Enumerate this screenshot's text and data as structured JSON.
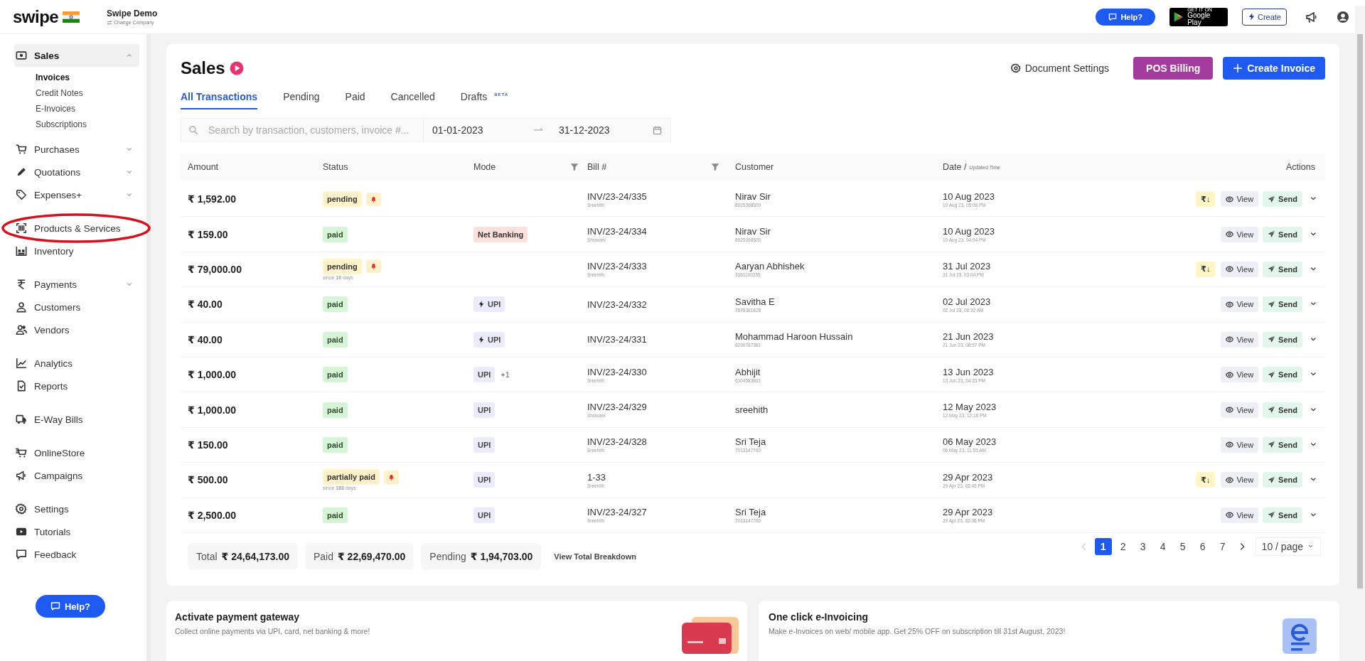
{
  "topbar": {
    "logo": "swipe",
    "company": "Swipe Demo",
    "change_company": "Change Company",
    "help": "Help?",
    "store_badge": {
      "small": "GET IT ON",
      "large": "Google Play"
    },
    "create": "Create"
  },
  "sidebar": {
    "groups": [
      [
        {
          "label": "Sales",
          "expanded": true,
          "selected": true,
          "children": [
            {
              "label": "Invoices",
              "selected": true
            },
            {
              "label": "Credit Notes",
              "selected": false
            },
            {
              "label": "E-Invoices",
              "selected": false
            },
            {
              "label": "Subscriptions",
              "selected": false
            }
          ]
        },
        {
          "label": "Purchases",
          "expanded": false,
          "selected": false
        },
        {
          "label": "Quotations",
          "expanded": false,
          "selected": false
        },
        {
          "label": "Expenses+",
          "expanded": false,
          "selected": false
        }
      ],
      [
        {
          "label": "Products & Services",
          "selected": false,
          "highlighted": true
        },
        {
          "label": "Inventory",
          "selected": false
        }
      ],
      [
        {
          "label": "Payments",
          "expanded": false,
          "selected": false
        },
        {
          "label": "Customers",
          "selected": false
        },
        {
          "label": "Vendors",
          "selected": false
        }
      ],
      [
        {
          "label": "Analytics",
          "selected": false
        },
        {
          "label": "Reports",
          "selected": false
        }
      ],
      [
        {
          "label": "E-Way Bills",
          "selected": false
        }
      ],
      [
        {
          "label": "OnlineStore",
          "selected": false
        },
        {
          "label": "Campaigns",
          "selected": false
        }
      ],
      [
        {
          "label": "Settings",
          "selected": false
        },
        {
          "label": "Tutorials",
          "selected": false
        },
        {
          "label": "Feedback",
          "selected": false
        }
      ]
    ],
    "help": "Help?"
  },
  "page": {
    "title": "Sales",
    "document_settings": "Document Settings",
    "pos_billing": "POS Billing",
    "create_invoice": "Create Invoice"
  },
  "tabs": [
    {
      "label": "All Transactions",
      "selected": true
    },
    {
      "label": "Pending",
      "selected": false
    },
    {
      "label": "Paid",
      "selected": false
    },
    {
      "label": "Cancelled",
      "selected": false
    },
    {
      "label": "Drafts",
      "selected": false,
      "badge": "BETA"
    }
  ],
  "search": {
    "placeholder": "Search by transaction, customers, invoice #...",
    "date_from": "01-01-2023",
    "date_to": "31-12-2023"
  },
  "table": {
    "columns": [
      {
        "label": "Amount",
        "filter": false
      },
      {
        "label": "Status",
        "filter": false
      },
      {
        "label": "Mode",
        "filter": true
      },
      {
        "label": "Bill #",
        "filter": true
      },
      {
        "label": "Customer",
        "filter": false
      },
      {
        "label": "Date /",
        "sublabel": "Updated Time",
        "filter": false
      },
      {
        "label": "Actions",
        "filter": false
      }
    ],
    "rows": [
      {
        "amount": "₹ 1,592.00",
        "status": {
          "label": "pending",
          "kind": "pending",
          "alert": true
        },
        "bill": "INV/23-24/335",
        "bill_sub": "Sreehith",
        "customer": "Nirav Sir",
        "phone": "8925398500",
        "date": "10 Aug 2023",
        "time": "10 Aug 23, 05:08 PM",
        "remind": "₹↓",
        "view": "View",
        "send": "Send"
      },
      {
        "amount": "₹ 159.00",
        "status": {
          "label": "paid",
          "kind": "paid",
          "alert": false
        },
        "mode": {
          "label": "Net Banking",
          "kind": "netbanking",
          "bolt": false
        },
        "bill": "INV/23-24/334",
        "bill_sub": "Shravani",
        "customer": "Nirav Sir",
        "phone": "8925398500",
        "date": "10 Aug 2023",
        "time": "10 Aug 23, 04:04 PM",
        "view": "View",
        "send": "Send"
      },
      {
        "amount": "₹ 79,000.00",
        "status": {
          "label": "pending",
          "kind": "pending",
          "alert": true,
          "note": "since **10** days"
        },
        "bill": "INV/23-24/333",
        "bill_sub": "Sreehith",
        "customer": "Aaryan Abhishek",
        "phone": "3361100255",
        "date": "31 Jul 2023",
        "time": "31 Jul 23, 03:04 PM",
        "remind": "₹↓",
        "view": "View",
        "send": "Send"
      },
      {
        "amount": "₹ 40.00",
        "status": {
          "label": "paid",
          "kind": "paid",
          "alert": false
        },
        "mode": {
          "label": "UPI",
          "kind": "upi",
          "bolt": true
        },
        "bill": "INV/23-24/332",
        "customer": "Savitha E",
        "phone": "7878381828",
        "date": "02 Jul 2023",
        "time": "02 Jul 23, 08:32 AM",
        "view": "View",
        "send": "Send"
      },
      {
        "amount": "₹ 40.00",
        "status": {
          "label": "paid",
          "kind": "paid",
          "alert": false
        },
        "mode": {
          "label": "UPI",
          "kind": "upi",
          "bolt": true
        },
        "bill": "INV/23-24/331",
        "customer": "Mohammad Haroon Hussain",
        "phone": "8290787381",
        "date": "21 Jun 2023",
        "time": "21 Jun 23, 08:57 PM",
        "view": "View",
        "send": "Send"
      },
      {
        "amount": "₹ 1,000.00",
        "status": {
          "label": "paid",
          "kind": "paid",
          "alert": false
        },
        "mode": {
          "label": "UPI",
          "kind": "upi",
          "bolt": false,
          "extra": "+1"
        },
        "bill": "INV/23-24/330",
        "bill_sub": "Sreehith",
        "customer": "Abhijit",
        "phone": "6304583881",
        "date": "13 Jun 2023",
        "time": "13 Jun 23, 04:33 PM",
        "view": "View",
        "send": "Send"
      },
      {
        "amount": "₹ 1,000.00",
        "status": {
          "label": "paid",
          "kind": "paid",
          "alert": false
        },
        "mode": {
          "label": "UPI",
          "kind": "upi",
          "bolt": false
        },
        "bill": "INV/23-24/329",
        "bill_sub": "Shravani",
        "customer": "sreehith",
        "date": "12 May 2023",
        "time": "12 May 23, 12:18 PM",
        "view": "View",
        "send": "Send"
      },
      {
        "amount": "₹ 150.00",
        "status": {
          "label": "paid",
          "kind": "paid",
          "alert": false
        },
        "mode": {
          "label": "UPI",
          "kind": "upi",
          "bolt": false
        },
        "bill": "INV/23-24/328",
        "bill_sub": "Sreehith",
        "customer": "Sri Teja",
        "phone": "7013147760",
        "date": "06 May 2023",
        "time": "06 May 23, 11:55 AM",
        "view": "View",
        "send": "Send"
      },
      {
        "amount": "₹ 500.00",
        "status": {
          "label": "partially paid",
          "kind": "partial",
          "alert": true,
          "note": "since **183** days"
        },
        "mode": {
          "label": "UPI",
          "kind": "upi",
          "bolt": false
        },
        "bill": "1-33",
        "bill_sub": "Sreehith",
        "date": "29 Apr 2023",
        "time": "29 Apr 23, 02:45 PM",
        "remind": "₹↓",
        "view": "View",
        "send": "Send"
      },
      {
        "amount": "₹ 2,500.00",
        "status": {
          "label": "paid",
          "kind": "paid",
          "alert": false
        },
        "mode": {
          "label": "UPI",
          "kind": "upi",
          "bolt": false
        },
        "bill": "INV/23-24/327",
        "bill_sub": "Sreehith",
        "customer": "Sri Teja",
        "phone": "7013147760",
        "date": "29 Apr 2023",
        "time": "29 Apr 23, 02:36 PM",
        "view": "View",
        "send": "Send"
      }
    ]
  },
  "totals": [
    {
      "label": "Total",
      "value": "₹ 24,64,173.00"
    },
    {
      "label": "Paid",
      "value": "₹ 22,69,470.00"
    },
    {
      "label": "Pending",
      "value": "₹ 1,94,703.00"
    }
  ],
  "totals_link": "View Total Breakdown",
  "pagination": {
    "pages": [
      {
        "label": "1",
        "selected": true
      },
      {
        "label": "2",
        "selected": false
      },
      {
        "label": "3",
        "selected": false
      },
      {
        "label": "4",
        "selected": false
      },
      {
        "label": "5",
        "selected": false
      },
      {
        "label": "6",
        "selected": false
      },
      {
        "label": "7",
        "selected": false
      }
    ],
    "page_size": "10 / page"
  },
  "promos": [
    {
      "kind": "payments",
      "title": "Activate payment gateway",
      "text": "Collect online payments via UPI, card, net banking & more!"
    },
    {
      "kind": "einvoice",
      "title": "One click e-Invoicing",
      "text": "Make e-Invoices on web/ mobile app. Get 25% OFF on subscription till 31st August, 2023!"
    }
  ]
}
